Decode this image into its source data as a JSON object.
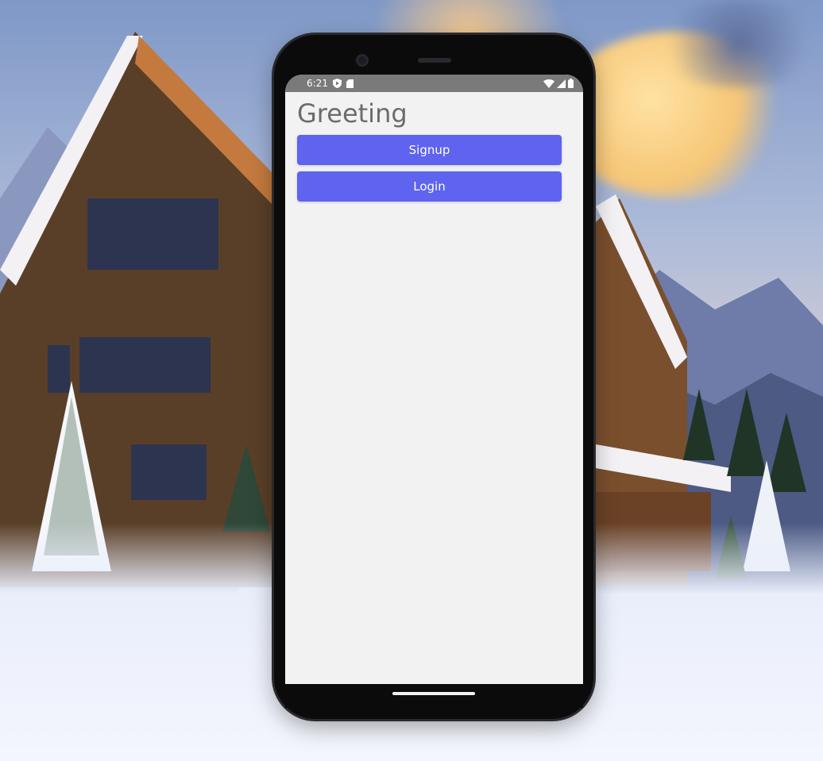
{
  "status_bar": {
    "time": "6:21",
    "left_icons": [
      "play-protect-icon",
      "sd-card-icon"
    ],
    "right_icons": [
      "wifi-icon",
      "cellular-signal-icon",
      "battery-icon"
    ]
  },
  "app": {
    "title": "Greeting",
    "buttons": {
      "signup": "Signup",
      "login": "Login"
    }
  },
  "colors": {
    "status_bar": "#7a7a7a",
    "screen_background": "#f2f2f2",
    "button": "#5e63f0",
    "button_text": "#ffffff",
    "title_text": "#6b6b6b"
  }
}
